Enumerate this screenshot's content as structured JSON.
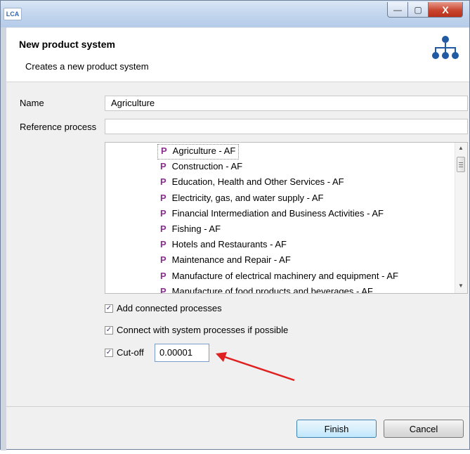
{
  "window": {
    "app_icon_text": "LCA",
    "minimize": "—",
    "maximize": "▢",
    "close": "X"
  },
  "header": {
    "title": "New product system",
    "description": "Creates a new product system",
    "icon": "hierarchy-icon"
  },
  "form": {
    "name_label": "Name",
    "name_value": "Agriculture",
    "reference_label": "Reference process",
    "reference_value": ""
  },
  "process_list": {
    "icon_letter": "P",
    "items": [
      "Agriculture - AF",
      "Construction - AF",
      "Education, Health and Other Services - AF",
      "Electricity, gas, and water supply - AF",
      "Financial Intermediation and Business Activities - AF",
      "Fishing - AF",
      "Hotels and Restaurants - AF",
      "Maintenance and Repair - AF",
      "Manufacture of electrical machinery and equipment - AF",
      "Manufacture of food products and beverages - AF"
    ],
    "selected_index": 0
  },
  "options": {
    "add_connected": {
      "label": "Add connected processes",
      "checked": true
    },
    "connect_system": {
      "label": "Connect with system processes if possible",
      "checked": true
    },
    "cutoff": {
      "label": "Cut-off",
      "checked": true,
      "value": "0.00001"
    }
  },
  "buttons": {
    "finish": "Finish",
    "cancel": "Cancel"
  },
  "colors": {
    "process_icon": "#8a2f8f",
    "annotation_arrow": "#e02020",
    "header_icon": "#1f5aa3"
  }
}
